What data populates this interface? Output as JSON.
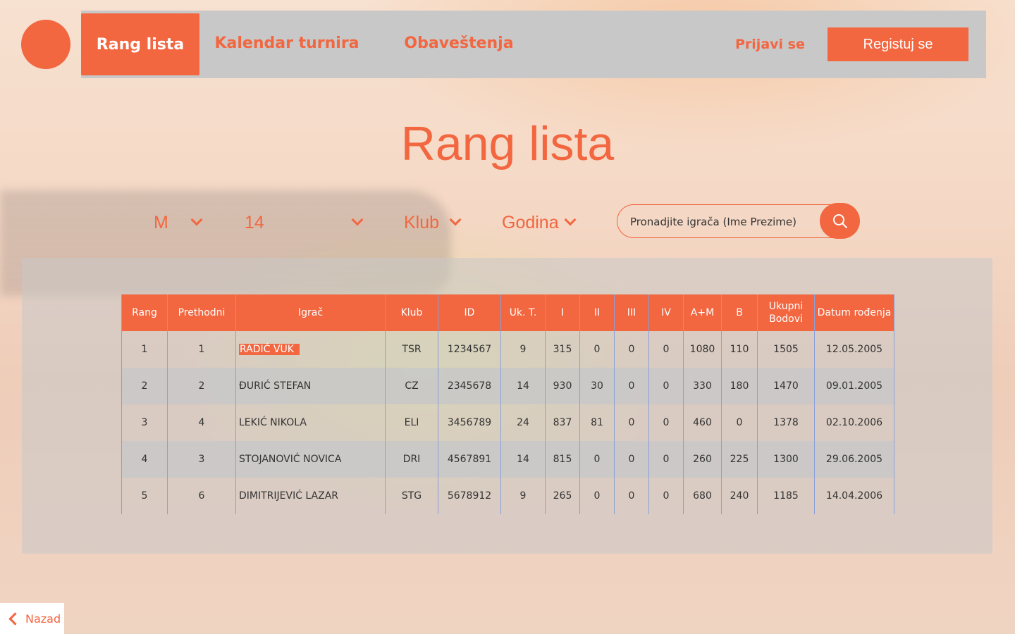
{
  "nav": {
    "tabs": [
      "Rang lista",
      "Kalendar turnira",
      "Obaveštenja"
    ],
    "login_label": "Prijavi se",
    "register_label": "Registuj se"
  },
  "page_title": "Rang lista",
  "filters": {
    "gender": "M",
    "age": "14",
    "club": "Klub",
    "year": "Godina"
  },
  "search": {
    "placeholder": "Pronadjite igrača (Ime Prezime)"
  },
  "table": {
    "headers": [
      "Rang",
      "Prethodni",
      "Igrač",
      "Klub",
      "ID",
      "Uk. T.",
      "I",
      "II",
      "III",
      "IV",
      "A+M",
      "B",
      "Ukupni Bodovi",
      "Datum rođenja"
    ],
    "rows": [
      [
        "1",
        "1",
        "RADIĆ VUK",
        "TSR",
        "1234567",
        "9",
        "315",
        "0",
        "0",
        "0",
        "1080",
        "110",
        "1505",
        "12.05.2005"
      ],
      [
        "2",
        "2",
        "ĐURIĆ STEFAN",
        "CZ",
        "2345678",
        "14",
        "930",
        "30",
        "0",
        "0",
        "330",
        "180",
        "1470",
        "09.01.2005"
      ],
      [
        "3",
        "4",
        "LEKIĆ NIKOLA",
        "ELI",
        "3456789",
        "24",
        "837",
        "81",
        "0",
        "0",
        "460",
        "0",
        "1378",
        "02.10.2006"
      ],
      [
        "4",
        "3",
        "STOJANOVIĆ NOVICA",
        "DRI",
        "4567891",
        "14",
        "815",
        "0",
        "0",
        "0",
        "260",
        "225",
        "1300",
        "29.06.2005"
      ],
      [
        "5",
        "6",
        "DIMITRIJEVIĆ LAZAR",
        "STG",
        "5678912",
        "9",
        "265",
        "0",
        "0",
        "0",
        "680",
        "240",
        "1185",
        "14.04.2006"
      ]
    ]
  },
  "back_label": "Nazad",
  "colors": {
    "accent": "#f26640",
    "nav_bg": "#c8c8c8"
  }
}
